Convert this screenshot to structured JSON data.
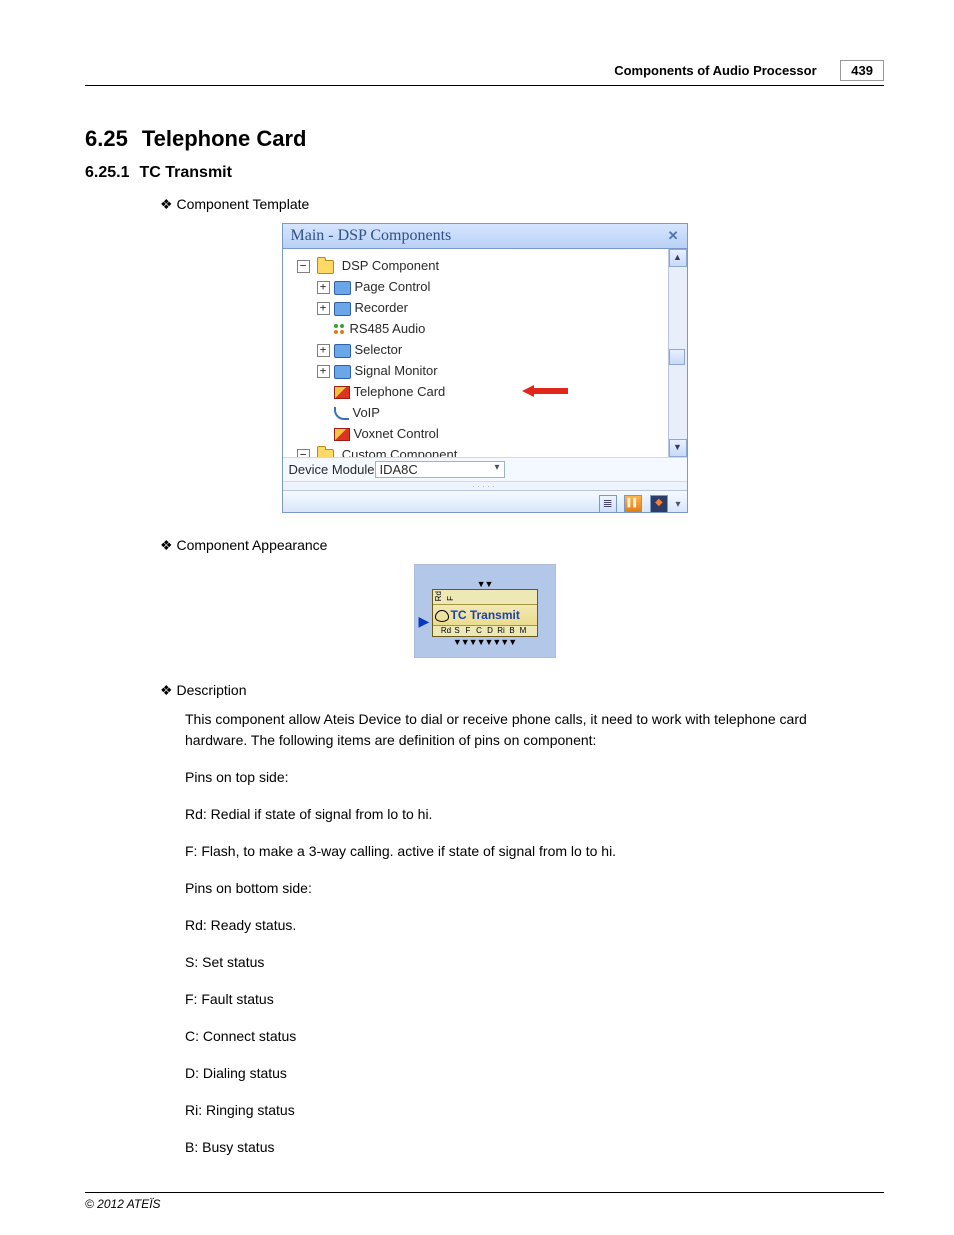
{
  "header": {
    "title": "Components of Audio Processor",
    "page": "439"
  },
  "section": {
    "num": "6.25",
    "title": "Telephone Card"
  },
  "subsection": {
    "num": "6.25.1",
    "title": "TC Transmit"
  },
  "labels": {
    "component_template": "Component Template",
    "component_appearance": "Component Appearance",
    "description": "Description"
  },
  "tree": {
    "title": "Main - DSP Components",
    "root": "DSP Component",
    "items": {
      "page_control": "Page Control",
      "recorder": "Recorder",
      "rs485": "RS485 Audio",
      "selector": "Selector",
      "signal_monitor": "Signal Monitor",
      "telephone_card": "Telephone Card",
      "voip": "VoIP",
      "voxnet": "Voxnet Control"
    },
    "custom": "Custom Component",
    "device_label": "Device Module",
    "device_value": "IDA8C"
  },
  "appearance": {
    "top_pins": "Rd F",
    "label": "TC Transmit",
    "bot_pins": [
      "Rd",
      "S",
      "F",
      "C",
      "D",
      "Ri",
      "B",
      "M"
    ]
  },
  "desc": {
    "intro": "This component allow Ateis Device to dial or receive phone calls, it need to work with telephone card hardware. The following items are definition of pins on component:",
    "top_heading": "Pins on top side:",
    "top": {
      "rd": "Rd: Redial if state of signal from lo to hi.",
      "f": "F: Flash, to make a 3-way calling. active if state of signal from lo to hi."
    },
    "bot_heading": "Pins on bottom side:",
    "bot": {
      "rd": "Rd: Ready status.",
      "s": "S: Set status",
      "f": "F: Fault status",
      "c": "C: Connect status",
      "d": "D: Dialing status",
      "ri": "Ri: Ringing status",
      "b": "B: Busy status"
    }
  },
  "footer": "© 2012 ATEÏS"
}
